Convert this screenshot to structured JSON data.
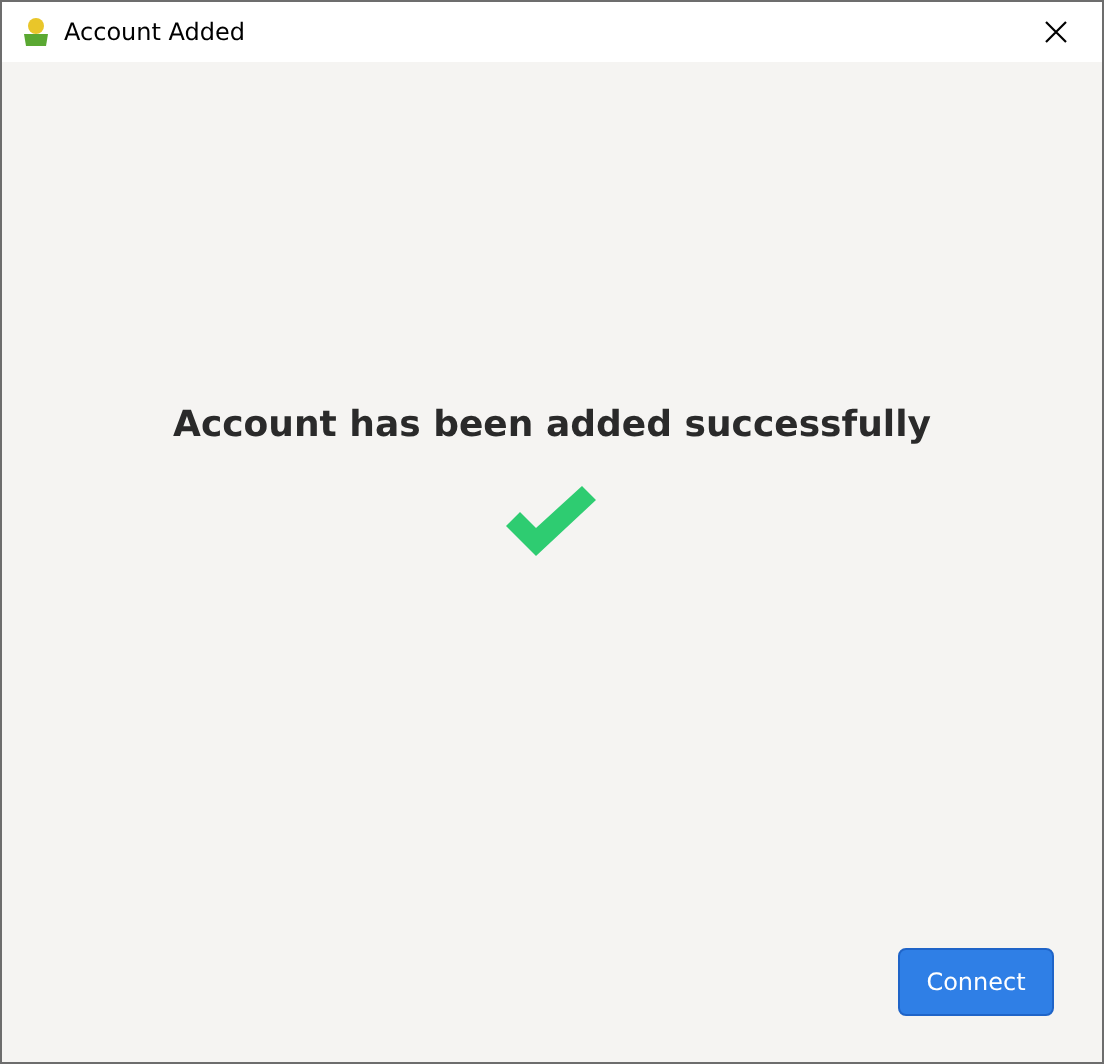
{
  "window": {
    "title": "Account Added"
  },
  "message": "Account has been added successfully",
  "buttons": [
    {
      "label": "Connect",
      "kind": "primary"
    }
  ]
}
